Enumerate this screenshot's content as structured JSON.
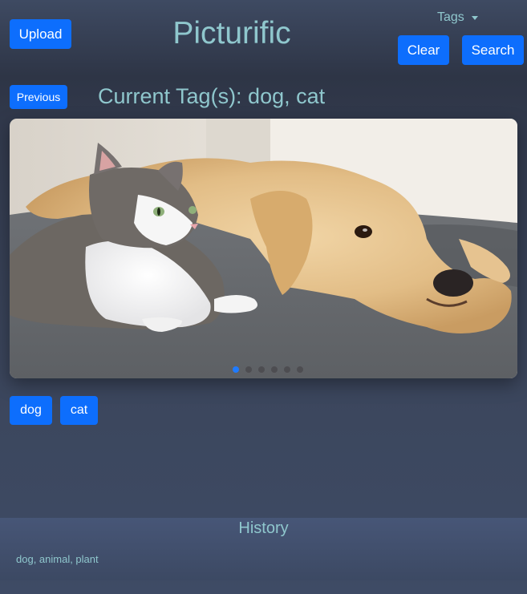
{
  "header": {
    "upload_label": "Upload",
    "title": "Picturific",
    "tags_dropdown_label": "Tags",
    "clear_label": "Clear",
    "search_label": "Search"
  },
  "viewer": {
    "previous_label": "Previous",
    "current_tags_text": "Current Tag(s): dog, cat",
    "image_subject": "cat and golden retriever lying on a gray blanket",
    "slide_count": 6,
    "active_slide": 1
  },
  "image_tags": [
    {
      "label": "dog"
    },
    {
      "label": "cat"
    }
  ],
  "history": {
    "title": "History",
    "entries": [
      "dog, animal, plant"
    ]
  },
  "colors": {
    "accent": "#0d6efd",
    "text_teal": "#8fc7cd",
    "background": "#3a4459"
  }
}
